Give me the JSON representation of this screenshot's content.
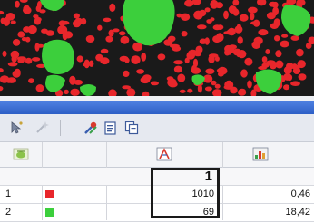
{
  "colors": {
    "image_background": "#1a1a1a",
    "red_particles": "#e8262b",
    "green_particles": "#3ccf3c",
    "titlebar": "#3a6fd8",
    "toolbar": "#e6e9f0"
  },
  "toolbar": {
    "icons": [
      "cursor-icon",
      "wand-icon",
      "tools-icon",
      "document-icon",
      "copy-icon"
    ]
  },
  "table": {
    "header_icons": [
      "particle-icon",
      "measure-icon",
      "histogram-icon"
    ],
    "column_label": "1",
    "rows": [
      {
        "index": "1",
        "class_color": "red",
        "value_a": "1010",
        "value_b": "0,46"
      },
      {
        "index": "2",
        "class_color": "green",
        "value_a": "69",
        "value_b": "18,42"
      }
    ]
  }
}
